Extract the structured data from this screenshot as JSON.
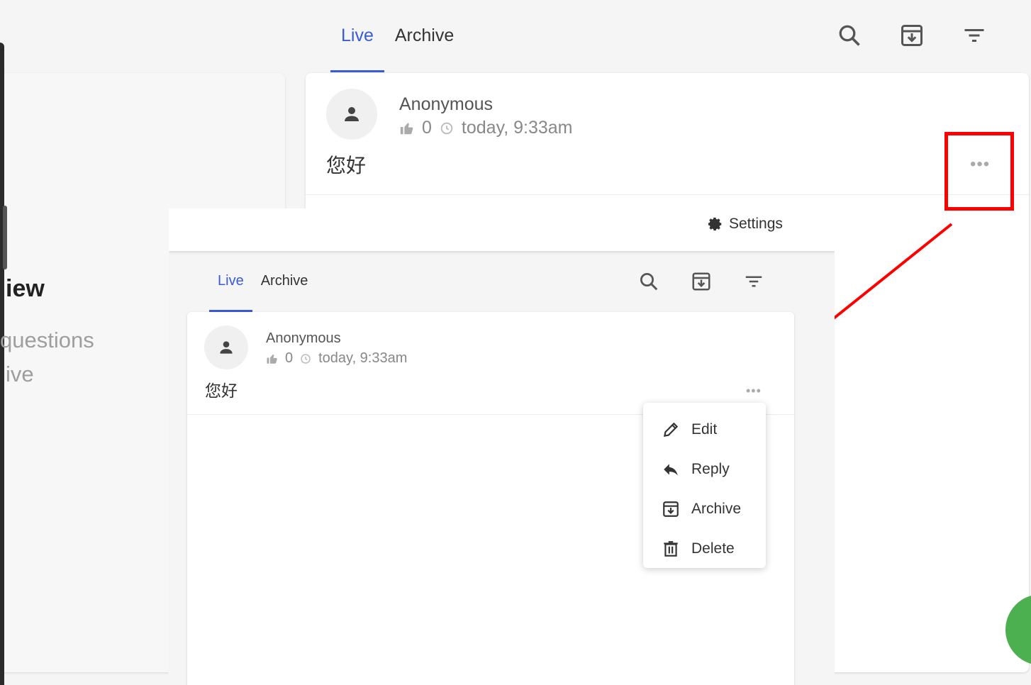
{
  "tabs": [
    {
      "label": "Live",
      "active": true
    },
    {
      "label": "Archive",
      "active": false
    }
  ],
  "left_panel": {
    "title_fragment": "iew",
    "line1": "questions",
    "line2": "ive"
  },
  "question": {
    "author": "Anonymous",
    "likes": "0",
    "time": "today, 9:33am",
    "body": "您好",
    "more": "•••"
  },
  "inset": {
    "settings_label": "Settings",
    "tabs": [
      {
        "label": "Live",
        "active": true
      },
      {
        "label": "Archive",
        "active": false
      }
    ],
    "question": {
      "author": "Anonymous",
      "likes": "0",
      "time": "today, 9:33am",
      "body": "您好",
      "more": "•••"
    },
    "menu": [
      {
        "label": "Edit",
        "icon": "pencil-icon"
      },
      {
        "label": "Reply",
        "icon": "reply-icon"
      },
      {
        "label": "Archive",
        "icon": "archive-icon"
      },
      {
        "label": "Delete",
        "icon": "trash-icon"
      }
    ]
  },
  "colors": {
    "accent": "#3a5bd9",
    "annotation": "#ff0000",
    "fab": "#4caf50"
  }
}
